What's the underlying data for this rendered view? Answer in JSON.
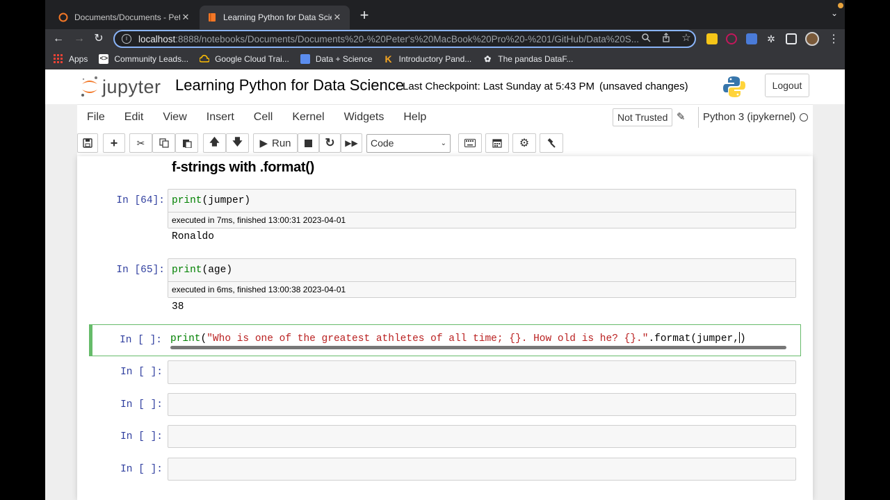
{
  "browser": {
    "tabs": [
      {
        "title": "Documents/Documents - Peter's",
        "active": false
      },
      {
        "title": "Learning Python for Data Science",
        "active": true
      }
    ],
    "url_host": "localhost",
    "url_rest": ":8888/notebooks/Documents/Documents%20-%20Peter's%20MacBook%20Pro%20-%201/GitHub/Data%20S...",
    "bookmarks": [
      {
        "label": "Apps",
        "icon": "apps-grid-icon"
      },
      {
        "label": "Community Leads...",
        "icon": "community-icon"
      },
      {
        "label": "Google Cloud Trai...",
        "icon": "google-cloud-icon"
      },
      {
        "label": "Data + Science",
        "icon": "data-science-icon"
      },
      {
        "label": "Introductory Pand...",
        "icon": "k-icon"
      },
      {
        "label": "The pandas DataF...",
        "icon": "pandas-icon"
      }
    ]
  },
  "jupyter": {
    "logo_text": "jupyter",
    "notebook_title": "Learning Python for Data Science",
    "checkpoint": "Last Checkpoint: Last Sunday at 5:43 PM",
    "unsaved": "(unsaved changes)",
    "logout": "Logout",
    "menu": [
      "File",
      "Edit",
      "View",
      "Insert",
      "Cell",
      "Kernel",
      "Widgets",
      "Help"
    ],
    "not_trusted": "Not Trusted",
    "kernel": "Python 3 (ipykernel)",
    "run_label": "Run",
    "cell_type": "Code"
  },
  "notebook": {
    "heading": "f-strings with .format()",
    "cells": [
      {
        "prompt": "In [64]:",
        "code_fn": "print",
        "code_rest": "(jumper)",
        "exec": "executed in 7ms, finished 13:00:31 2023-04-01",
        "output": "Ronaldo"
      },
      {
        "prompt": "In [65]:",
        "code_fn": "print",
        "code_rest": "(age)",
        "exec": "executed in 6ms, finished 13:00:38 2023-04-01",
        "output": "38"
      },
      {
        "prompt": "In [ ]:",
        "code_fn": "print",
        "code_open": "(",
        "code_str": "\"Who is one of the greatest athletes of all time; {}. How old is he? {}.\"",
        "code_tail": ".format(jumper,",
        "code_close": ")"
      }
    ],
    "empty_prompts": [
      "In [ ]:",
      "In [ ]:",
      "In [ ]:",
      "In [ ]:"
    ]
  }
}
